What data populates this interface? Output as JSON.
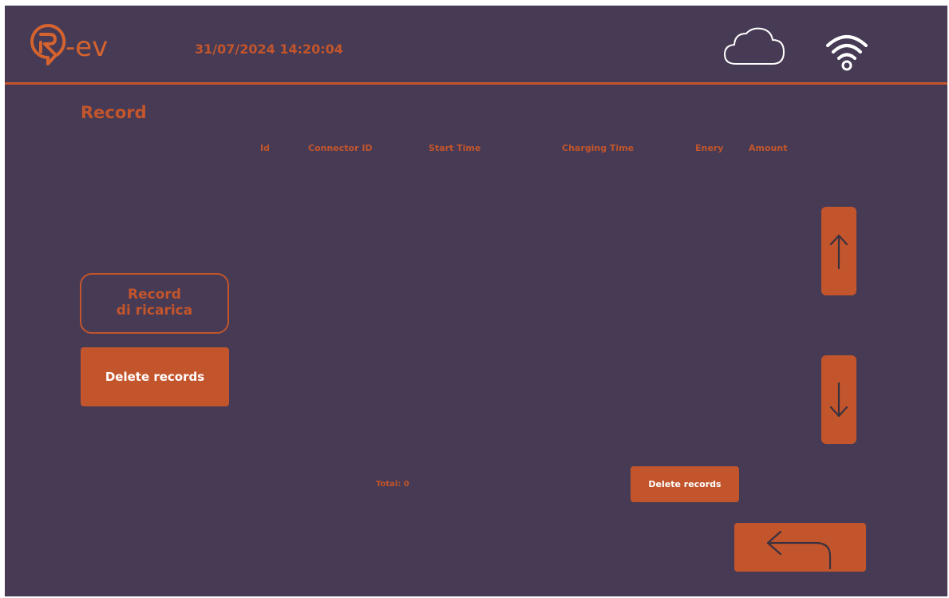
{
  "header": {
    "logo_text": "-ev",
    "datetime": "31/07/2024 14:20:04",
    "icons": [
      "logo-icon",
      "cloud-icon",
      "wifi-icon"
    ]
  },
  "page": {
    "title": "Record"
  },
  "table": {
    "columns": [
      "Id",
      "Connector ID",
      "Start Time",
      "Charging Time",
      "Enery",
      "Amount"
    ],
    "rows": []
  },
  "sidebar": {
    "record_button_line1": "Record",
    "record_button_line2": "di ricarica",
    "delete_button": "Delete records"
  },
  "scroll": {
    "up_icon": "arrow-up-icon",
    "down_icon": "arrow-down-icon"
  },
  "footer": {
    "total_label": "Total: 0",
    "delete_button": "Delete records",
    "back_icon": "return-arrow-icon"
  },
  "colors": {
    "background": "#463a54",
    "accent": "#c2552c",
    "text_on_accent": "#ffffff"
  }
}
